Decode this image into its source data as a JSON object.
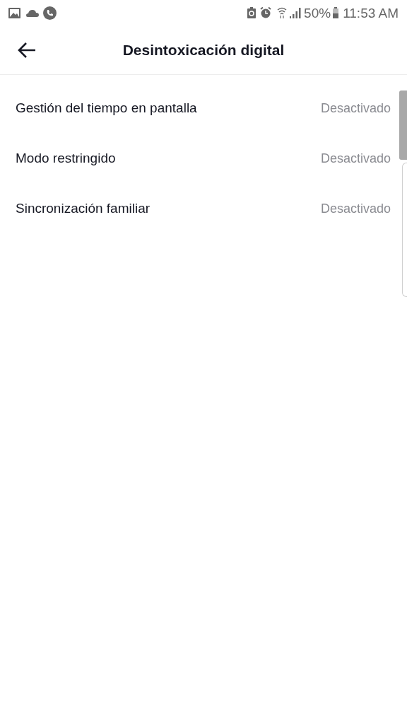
{
  "status_bar": {
    "battery": "50%",
    "time": "11:53 AM"
  },
  "header": {
    "title": "Desintoxicación digital"
  },
  "settings": [
    {
      "label": "Gestión del tiempo en pantalla",
      "value": "Desactivado"
    },
    {
      "label": "Modo restringido",
      "value": "Desactivado"
    },
    {
      "label": "Sincronización familiar",
      "value": "Desactivado"
    }
  ]
}
